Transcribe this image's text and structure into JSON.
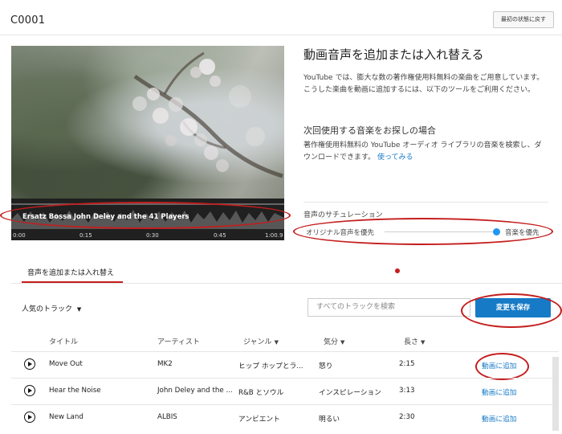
{
  "video": {
    "title": "C0001",
    "reset_label": "最初の状態に戻す"
  },
  "audio_panel": {
    "track_label": "Ersatz Bossa John Deley and the 41 Players",
    "timestamps": [
      "0:00",
      "0:15",
      "0:30",
      "0:45",
      "1:00.9"
    ]
  },
  "info": {
    "heading": "動画音声を追加または入れ替える",
    "description": "YouTube では、膨大な数の著作権使用料無料の楽曲をご用意しています。こうした楽曲を動画に追加するには、以下のツールをご利用ください。",
    "next_heading": "次回使用する音楽をお探しの場合",
    "next_description": "著作権使用料無料の YouTube オーディオ ライブラリの音楽を検索し、ダウンロードできます。",
    "try_link": "使ってみる"
  },
  "saturation": {
    "label": "音声のサチュレーション",
    "left": "オリジナル音声を優先",
    "right": "音楽を優先",
    "value": 1.0
  },
  "tab": {
    "label": "音声を追加または入れ替え"
  },
  "toolbar": {
    "dropdown": "人気のトラック",
    "search_placeholder": "すべてのトラックを検索",
    "save_label": "変更を保存"
  },
  "table": {
    "headers": [
      "タイトル",
      "アーティスト",
      "ジャンル",
      "気分",
      "長さ"
    ],
    "rows": [
      {
        "title": "Move Out",
        "artist": "MK2",
        "genre": "ヒップ ホップとラ...",
        "mood": "怒り",
        "length": "2:15",
        "action": "動画に追加"
      },
      {
        "title": "Hear the Noise",
        "artist": "John Deley and the ...",
        "genre": "R&B とソウル",
        "mood": "インスピレーション",
        "length": "3:13",
        "action": "動画に追加"
      },
      {
        "title": "New Land",
        "artist": "ALBIS",
        "genre": "アンビエント",
        "mood": "明るい",
        "length": "2:30",
        "action": "動画に追加"
      }
    ]
  },
  "icons": {
    "play": "play-icon",
    "dropdown": "chevron-down-icon",
    "sort": "sort-down-icon"
  },
  "colors": {
    "accent": "#167ac6",
    "annotation": "#c51d1d",
    "slider": "#2196f3"
  }
}
